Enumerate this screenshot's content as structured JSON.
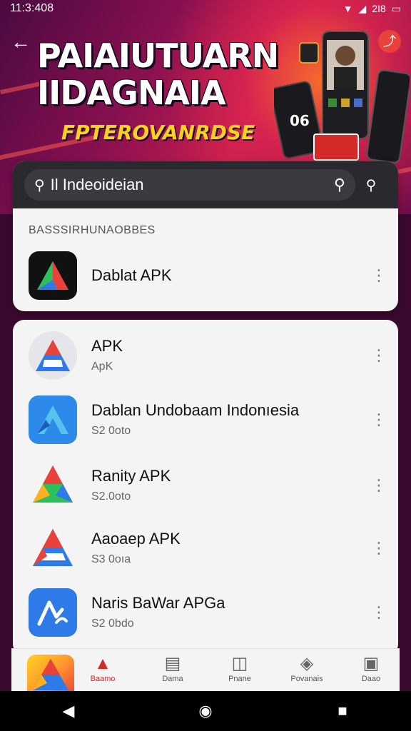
{
  "status_bar": {
    "time": "11:3:408",
    "icons": [
      "wifi-icon",
      "signal-icon",
      "battery-icon"
    ],
    "extra": "2I8"
  },
  "hero": {
    "title_line1": "PAIAIUTUARN",
    "title_line2": "IIDAGNAIA",
    "subtitle": "FPTEROVANRDSE",
    "phone_badge": "06"
  },
  "search": {
    "query": "Il Indeoideian"
  },
  "section_label": "BASSSIRHUNAOBBES",
  "featured": {
    "name": "Dablat APK"
  },
  "apps": [
    {
      "title": "APK",
      "subtitle": "ApK"
    },
    {
      "title": "Dablan Undobaam Indonıesia",
      "subtitle": "S2 0oto"
    },
    {
      "title": "Ranity APK",
      "subtitle": "S2.0oto"
    },
    {
      "title": "Aaoaep APK",
      "subtitle": "S3 0oıa"
    },
    {
      "title": "Naris BaWar APGa",
      "subtitle": "S2 0bdo"
    }
  ],
  "bottom_nav": [
    {
      "label": "Baamo",
      "icon": "home-icon",
      "active": true
    },
    {
      "label": "Dama",
      "icon": "calendar-icon",
      "active": false
    },
    {
      "label": "Pnane",
      "icon": "chat-icon",
      "active": false
    },
    {
      "label": "Povanais",
      "icon": "box-icon",
      "active": false
    },
    {
      "label": "Daao",
      "icon": "profile-icon",
      "active": false
    }
  ],
  "colors": {
    "accent": "#d42a2a",
    "hero_yellow": "#ffd21e",
    "search_bar": "#2a2a2e"
  }
}
